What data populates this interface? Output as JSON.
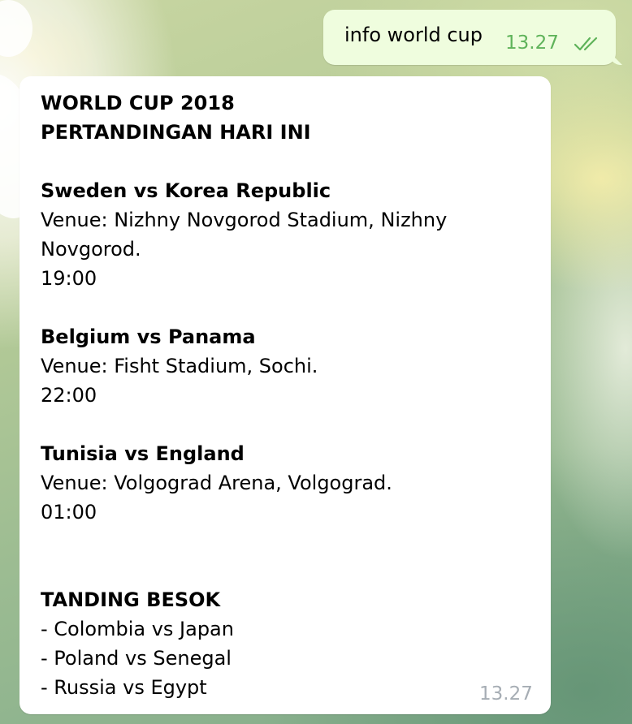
{
  "outgoing": {
    "text": "info world cup",
    "time": "13.27",
    "status_icon": "double-check-icon",
    "status_color": "#5fb35a"
  },
  "incoming": {
    "time": "13.27",
    "lines": {
      "title1": "WORLD CUP 2018",
      "title2": "PERTANDINGAN HARI INI",
      "match1_name": "Sweden vs Korea Republic",
      "match1_venue_a": "Venue: Nizhny Novgorod Stadium, Nizhny",
      "match1_venue_b": "Novgorod.",
      "match1_time": "19:00",
      "match2_name": "Belgium vs Panama",
      "match2_venue": "Venue: Fisht Stadium, Sochi.",
      "match2_time": "22:00",
      "match3_name": "Tunisia vs England",
      "match3_venue": "Venue: Volgograd Arena, Volgograd.",
      "match3_time": "01:00",
      "tomorrow_title": "TANDING BESOK",
      "tomorrow_1": "- Colombia vs Japan",
      "tomorrow_2": "- Poland vs Senegal",
      "tomorrow_3": "- Russia vs Egypt"
    }
  },
  "colors": {
    "outgoing_bubble": "#effdde",
    "incoming_bubble": "#ffffff",
    "incoming_time": "#a6adb4"
  }
}
